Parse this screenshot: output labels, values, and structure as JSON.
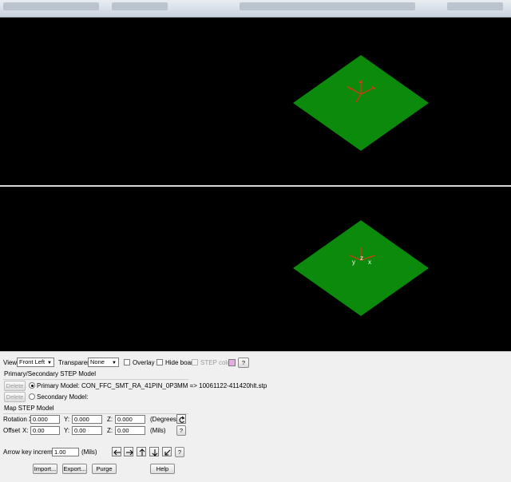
{
  "colors": {
    "board": "#0b8a0b",
    "axis": "#cc3b14",
    "background": "#000000"
  },
  "view": {
    "view_label": "View:",
    "view_value": "Front Left",
    "transparent_label": "Transparent:",
    "transparent_value": "None",
    "overlay_label": "Overlay",
    "hide_board_label": "Hide board",
    "step_color_label": "STEP color",
    "help_label": "?"
  },
  "primary": {
    "group_title": "Primary/Secondary STEP Model",
    "delete_label": "Delete",
    "primary_model_label": "Primary Model:",
    "primary_model_value": "CON_FFC_SMT_RA_41PIN_0P3MM => 10061122-411420hlt.stp",
    "secondary_model_label": "Secondary Model:"
  },
  "map": {
    "group_title": "Map STEP Model",
    "rotation_label": "Rotation X:",
    "rotation_x": "0.000",
    "rotation_y": "0.000",
    "rotation_z": "0.000",
    "rotation_unit": "(Degrees)",
    "offset_label": "Offset",
    "offset_x_label": "X:",
    "offset_x": "0.00",
    "offset_y": "0.00",
    "offset_z": "0.00",
    "offset_unit": "(Mils)",
    "y_label": "Y:",
    "z_label": "Z:",
    "help_label": "?"
  },
  "arrows": {
    "increment_label": "Arrow key increment:",
    "increment_value": "1.00",
    "increment_unit": "(Mils)",
    "help_label": "?"
  },
  "footer": {
    "import_label": "Import...",
    "export_label": "Export...",
    "purge_label": "Purge",
    "help_label": "Help"
  },
  "axes_bottom": {
    "y": "y",
    "z": "z",
    "x": "x"
  }
}
